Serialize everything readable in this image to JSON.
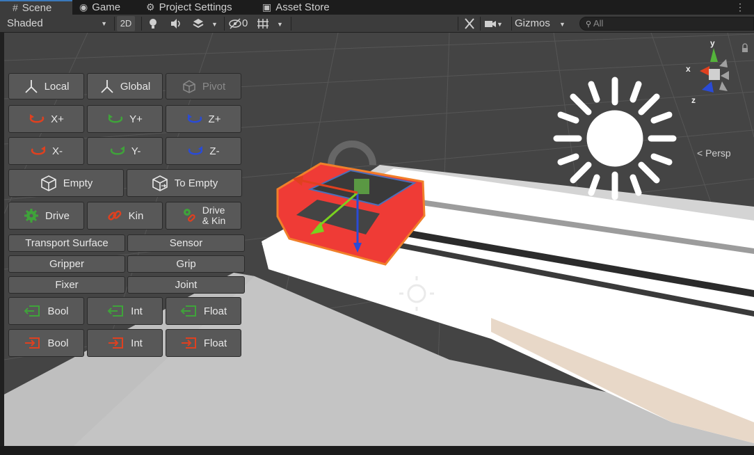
{
  "tabs": [
    {
      "label": "Scene",
      "icon": "grid-icon"
    },
    {
      "label": "Game",
      "icon": "gamepad-icon"
    },
    {
      "label": "Project Settings",
      "icon": "gear-icon"
    },
    {
      "label": "Asset Store",
      "icon": "bag-icon"
    }
  ],
  "toolbar": {
    "shading_mode": "Shaded",
    "mode_2d": "2D",
    "hidden_count": "0",
    "gizmos_label": "Gizmos",
    "search_placeholder": "All"
  },
  "gizmo": {
    "x_label": "x",
    "y_label": "y",
    "z_label": "z",
    "projection": "Persp"
  },
  "panel": {
    "orientation": [
      "Local",
      "Global",
      "Pivot"
    ],
    "rotate_plus": [
      "X+",
      "Y+",
      "Z+"
    ],
    "rotate_minus": [
      "X-",
      "Y-",
      "Z-"
    ],
    "empty": [
      "Empty",
      "To Empty"
    ],
    "drive": [
      "Drive",
      "Kin",
      "Drive",
      "& Kin"
    ],
    "components": [
      "Transport Surface",
      "Sensor",
      "Gripper",
      "Grip",
      "Fixer",
      "Joint"
    ],
    "signals_in": [
      "Bool",
      "Int",
      "Float"
    ],
    "signals_out": [
      "Bool",
      "Int",
      "Float"
    ]
  },
  "colors": {
    "x_axis": "#e0401f",
    "y_axis": "#3fa33a",
    "z_axis": "#2a4bd6",
    "selection": "#f07f2a",
    "cart": "#ef3b36"
  }
}
